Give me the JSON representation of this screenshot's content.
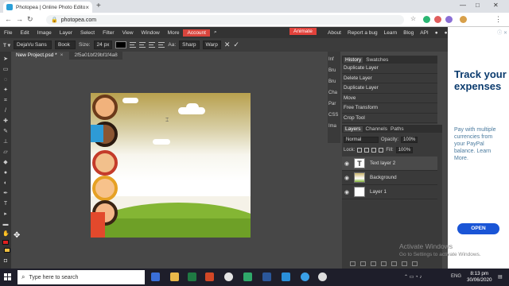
{
  "browser": {
    "tab_title": "Photopea | Online Photo Editor",
    "tab_close": "×",
    "new_tab": "+",
    "url": "photopea.com",
    "window_minimize": "—",
    "window_maximize": "□",
    "window_close": "✕"
  },
  "menu": {
    "items": [
      "File",
      "Edit",
      "Image",
      "Layer",
      "Select",
      "Filter",
      "View",
      "Window",
      "More"
    ],
    "account": "Account",
    "animate": "Animate",
    "right_items": [
      "About",
      "Report a bug",
      "Learn",
      "Blog",
      "API"
    ]
  },
  "options": {
    "font_family": "DejaVu Sans",
    "font_style": "Book",
    "size_label": "Size:",
    "size_value": "24 px",
    "aa_label": "Aa:",
    "aa_value": "Sharp",
    "warp": "Warp"
  },
  "documents": [
    {
      "name": "New Project.psd *",
      "close": "×"
    },
    {
      "name": "2f5a01bf29bf1f4a8",
      "close": ""
    }
  ],
  "side_panels": [
    "Inf",
    "Bru",
    "Bru",
    "Cha",
    "Par",
    "CSS",
    "Ima"
  ],
  "history": {
    "tabs": [
      "History",
      "Swatches"
    ],
    "items": [
      "Duplicate Layer",
      "Delete Layer",
      "Duplicate Layer",
      "Move",
      "Free Transform",
      "Crop Tool"
    ]
  },
  "layers": {
    "tabs": [
      "Layers",
      "Channels",
      "Paths"
    ],
    "blend_mode": "Normal",
    "opacity_label": "Opacity:",
    "opacity": "100%",
    "lock_label": "Lock:",
    "fill_label": "Fill:",
    "fill": "100%",
    "items": [
      {
        "name": "Text layer 2",
        "thumb": "T"
      },
      {
        "name": "Background",
        "thumb": ""
      },
      {
        "name": "Layer 1",
        "thumb": ""
      }
    ]
  },
  "ad": {
    "headline": "Track your expenses",
    "body": "Pay with multiple currencies from your PayPal balance. Learn More.",
    "button": "OPEN",
    "corner": "ⓘ ✕"
  },
  "watermark": {
    "title": "Activate Windows",
    "subtitle": "Go to Settings to activate Windows."
  },
  "taskbar": {
    "search_placeholder": "Type here to search",
    "language": "ENG",
    "time": "8:13 pm",
    "date": "30/06/2020"
  },
  "colors": {
    "accent_red": "#d9453d",
    "foreground": "#e02020",
    "background": "#f0c040"
  }
}
